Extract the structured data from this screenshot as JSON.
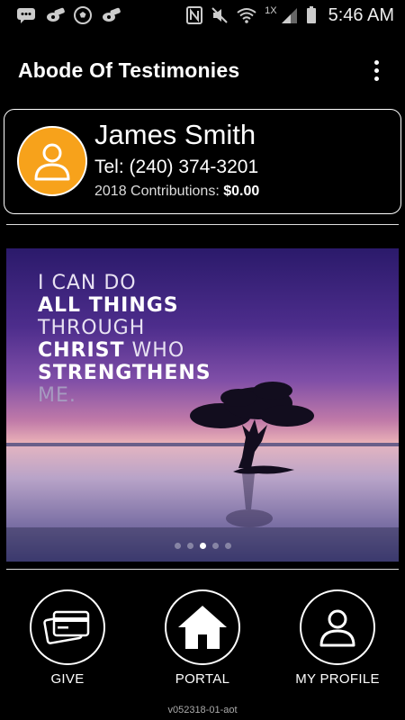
{
  "status_bar": {
    "time": "5:46 AM",
    "signal_label": "1X",
    "icons": [
      "message-icon",
      "whistle-icon",
      "soccer-ball-icon",
      "whistle-icon",
      "nfc-icon",
      "mute-icon",
      "wifi-icon",
      "signal-icon",
      "battery-icon"
    ]
  },
  "app_bar": {
    "title": "Abode Of Testimonies",
    "menu_icon": "overflow-menu-icon"
  },
  "profile": {
    "name": "James Smith",
    "tel": "Tel: (240) 374-3201",
    "contrib_label": "2018 Contributions:",
    "contrib_value": "$0.00",
    "avatar_icon": "person-icon",
    "avatar_color": "#f7a21b"
  },
  "banner": {
    "quote_lines": [
      "I CAN DO",
      "ALL THINGS",
      "THROUGH",
      "CHRIST",
      "WHO",
      "STRENGTHENS",
      "ME."
    ],
    "slide_count": 5,
    "active_slide": 3
  },
  "nav": {
    "give_label": "GIVE",
    "portal_label": "PORTAL",
    "profile_label": "MY PROFILE"
  },
  "version": "v052318-01-aot"
}
